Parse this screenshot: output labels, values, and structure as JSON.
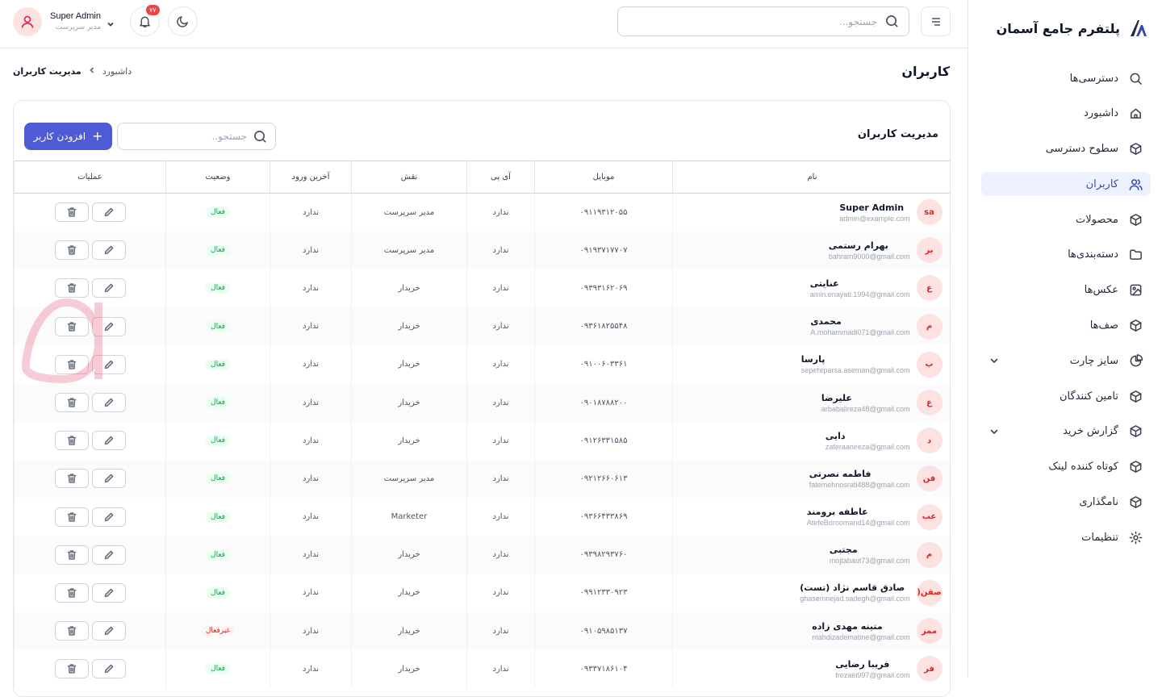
{
  "app": {
    "brand_title": "پلتفرم جامع آسمان"
  },
  "sidebar": {
    "items": [
      {
        "label": "دسترسی‌ها",
        "icon": "search-icon"
      },
      {
        "label": "داشبورد",
        "icon": "home-icon"
      },
      {
        "label": "سطوح دسترسی",
        "icon": "cube-icon"
      },
      {
        "label": "کاربران",
        "icon": "users-icon",
        "active": true
      },
      {
        "label": "محصولات",
        "icon": "cube-icon"
      },
      {
        "label": "دسته‌بندی‌ها",
        "icon": "folder-icon"
      },
      {
        "label": "عکس‌ها",
        "icon": "image-icon"
      },
      {
        "label": "صف‌ها",
        "icon": "cube-icon"
      },
      {
        "label": "سایز چارت",
        "icon": "pie-chart-icon",
        "expandable": true
      },
      {
        "label": "تامین کنندگان",
        "icon": "cube-icon"
      },
      {
        "label": "گزارش خرید",
        "icon": "cube-icon",
        "expandable": true
      },
      {
        "label": "کوتاه کننده لینک",
        "icon": "cube-icon"
      },
      {
        "label": "نامگذاری",
        "icon": "cube-icon"
      },
      {
        "label": "تنظیمات",
        "icon": "gear-icon"
      }
    ]
  },
  "topbar": {
    "search_placeholder": "جستجو...",
    "notification_count": "۷۷",
    "user_name": "Super Admin",
    "user_role": "مدیر سرپرست"
  },
  "page": {
    "title": "کاربران",
    "breadcrumb_home": "داشبورد",
    "breadcrumb_current": "مدیریت کاربران"
  },
  "card": {
    "title": "مدیریت کاربران",
    "search_placeholder": "جستجو..",
    "add_button": "افزودن کاربر"
  },
  "table": {
    "headers": {
      "name": "نام",
      "mobile": "موبایل",
      "ip": "آی پی",
      "role": "نقش",
      "last_login": "آخرین ورود",
      "status": "وضعیت",
      "actions": "عملیات"
    },
    "rows": [
      {
        "initials": "sa",
        "name": "Super Admin",
        "email": "admin@example.com",
        "mobile": "۰۹۱۱۹۳۱۲۰۵۵",
        "ip": "ندارد",
        "role": "مدیر سرپرست",
        "last_login": "ندارد",
        "status": "فعال",
        "active": true
      },
      {
        "initials": "بر",
        "name": "بهرام رستمی",
        "email": "bahram9000@gmail.com",
        "mobile": "۰۹۱۹۳۷۱۷۷۰۷",
        "ip": "ندارد",
        "role": "مدیر سرپرست",
        "last_login": "ندارد",
        "status": "فعال",
        "active": true
      },
      {
        "initials": "ع",
        "name": "عنایتی",
        "email": "amin.enayati.1994@gmail.com",
        "mobile": "۰۹۳۹۳۱۶۲۰۶۹",
        "ip": "ندارد",
        "role": "خریدار",
        "last_login": "ندارد",
        "status": "فعال",
        "active": true
      },
      {
        "initials": "م",
        "name": "محمدی",
        "email": "A.mohammadi071@gmail.com",
        "mobile": "۰۹۳۶۱۸۲۵۵۴۸",
        "ip": "ندارد",
        "role": "خریدار",
        "last_login": "ندارد",
        "status": "فعال",
        "active": true
      },
      {
        "initials": "پ",
        "name": "پارسا",
        "email": "sepehrparsa.aseman@gmail.com",
        "mobile": "۰۹۱۰۰۶۰۳۳۶۱",
        "ip": "ندارد",
        "role": "خریدار",
        "last_login": "ندارد",
        "status": "فعال",
        "active": true
      },
      {
        "initials": "ع",
        "name": "علیرضا",
        "email": "arbabalireza48@gmail.com",
        "mobile": "۰۹۰۱۸۷۸۸۲۰۰",
        "ip": "ندارد",
        "role": "خریدار",
        "last_login": "ندارد",
        "status": "فعال",
        "active": true
      },
      {
        "initials": "د",
        "name": "دایی",
        "email": "zaferaanireza@gmail.com",
        "mobile": "۰۹۱۲۶۳۳۱۵۸۵",
        "ip": "ندارد",
        "role": "خریدار",
        "last_login": "ندارد",
        "status": "فعال",
        "active": true
      },
      {
        "initials": "فن",
        "name": "فاطمه نصرتی",
        "email": "fatemehnosrati488@gmail.com",
        "mobile": "۰۹۲۱۲۶۶۰۶۱۳",
        "ip": "ندارد",
        "role": "مدیر سرپرست",
        "last_login": "ندارد",
        "status": "فعال",
        "active": true
      },
      {
        "initials": "عب",
        "name": "عاطفه برومند",
        "email": "AtefeBoroomand14@gmail.com",
        "mobile": "۰۹۳۶۶۴۳۳۸۶۹",
        "ip": "ندارد",
        "role": "Marketer",
        "last_login": "ندارد",
        "status": "فعال",
        "active": true
      },
      {
        "initials": "م",
        "name": "مجتبی",
        "email": "mojtabaut73@gmail.com",
        "mobile": "۰۹۳۹۸۲۹۳۷۶۰",
        "ip": "ندارد",
        "role": "خریدار",
        "last_login": "ندارد",
        "status": "فعال",
        "active": true
      },
      {
        "initials": "صقن(",
        "name": "صادق قاسم نژاد (تست)",
        "email": "ghasemnejad.sadegh@gmail.com",
        "mobile": "۰۹۹۱۲۳۳۰۹۲۳",
        "ip": "ندارد",
        "role": "خریدار",
        "last_login": "ندارد",
        "status": "فعال",
        "active": true
      },
      {
        "initials": "ممز",
        "name": "متینه مهدی زاده",
        "email": "mahdizadematine@gmail.com",
        "mobile": "۰۹۱۰۵۹۸۵۱۳۷",
        "ip": "ندارد",
        "role": "خریدار",
        "last_login": "ندارد",
        "status": "غیرفعال",
        "active": false
      },
      {
        "initials": "فر",
        "name": "فریبا رضایی",
        "email": "frezaei997@gmail.com",
        "mobile": "۰۹۳۳۷۱۸۶۱۰۴",
        "ip": "ندارد",
        "role": "خریدار",
        "last_login": "ندارد",
        "status": "فعال",
        "active": true
      }
    ]
  },
  "colors": {
    "accent": "#4f5bd5",
    "active_bg": "#eef2ff",
    "avatar_bg": "#fde2e2",
    "avatar_text": "#dc2626",
    "status_ok": "#16a34a",
    "status_bad": "#dc2626"
  }
}
